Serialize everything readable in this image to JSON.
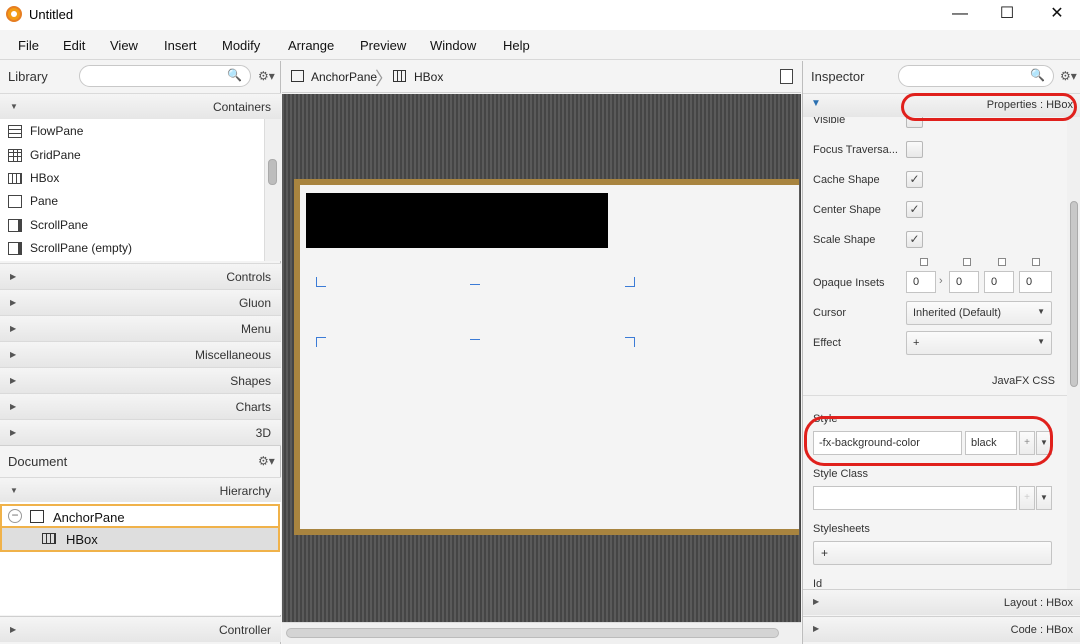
{
  "window": {
    "title": "Untitled",
    "minimize": "—",
    "maximize": "☐",
    "close": "✕"
  },
  "menu": [
    "File",
    "Edit",
    "View",
    "Insert",
    "Modify",
    "Arrange",
    "Preview",
    "Window",
    "Help"
  ],
  "library": {
    "title": "Library",
    "search_icon": "🔍",
    "gear_icon": "⚙▾",
    "containers_label": "Containers",
    "containers": [
      "FlowPane",
      "GridPane",
      "HBox",
      "Pane",
      "ScrollPane",
      "ScrollPane  (empty)"
    ],
    "sections": [
      "Controls",
      "Gluon",
      "Menu",
      "Miscellaneous",
      "Shapes",
      "Charts",
      "3D"
    ]
  },
  "document": {
    "title": "Document",
    "gear_icon": "⚙▾",
    "hierarchy_label": "Hierarchy",
    "items": [
      "AnchorPane",
      "HBox"
    ],
    "controller_label": "Controller"
  },
  "breadcrumb": [
    "AnchorPane",
    "HBox"
  ],
  "inspector": {
    "title": "Inspector",
    "search_icon": "🔍",
    "gear_icon": "⚙▾",
    "properties_label": "Properties : HBox",
    "visible_label": "Visible",
    "focus_label": "Focus Traversa...",
    "cache_label": "Cache Shape",
    "center_label": "Center Shape",
    "scale_label": "Scale Shape",
    "check": "✓",
    "insets_label": "Opaque Insets",
    "insets": [
      "0",
      "0",
      "0",
      "0"
    ],
    "cursor_label": "Cursor",
    "cursor_value": "Inherited (Default)",
    "effect_label": "Effect",
    "effect_value": "+",
    "css_section": "JavaFX CSS",
    "style_label": "Style",
    "style_property": "-fx-background-color",
    "style_value": "black",
    "style_class_label": "Style Class",
    "stylesheets_label": "Stylesheets",
    "stylesheets_button": "+",
    "id_label": "Id",
    "layout_label": "Layout : HBox",
    "code_label": "Code : HBox"
  },
  "colors": {
    "accent_orange": "#f0b24a",
    "anchor_border": "#a8843f",
    "annotation_red": "#e0201c"
  }
}
